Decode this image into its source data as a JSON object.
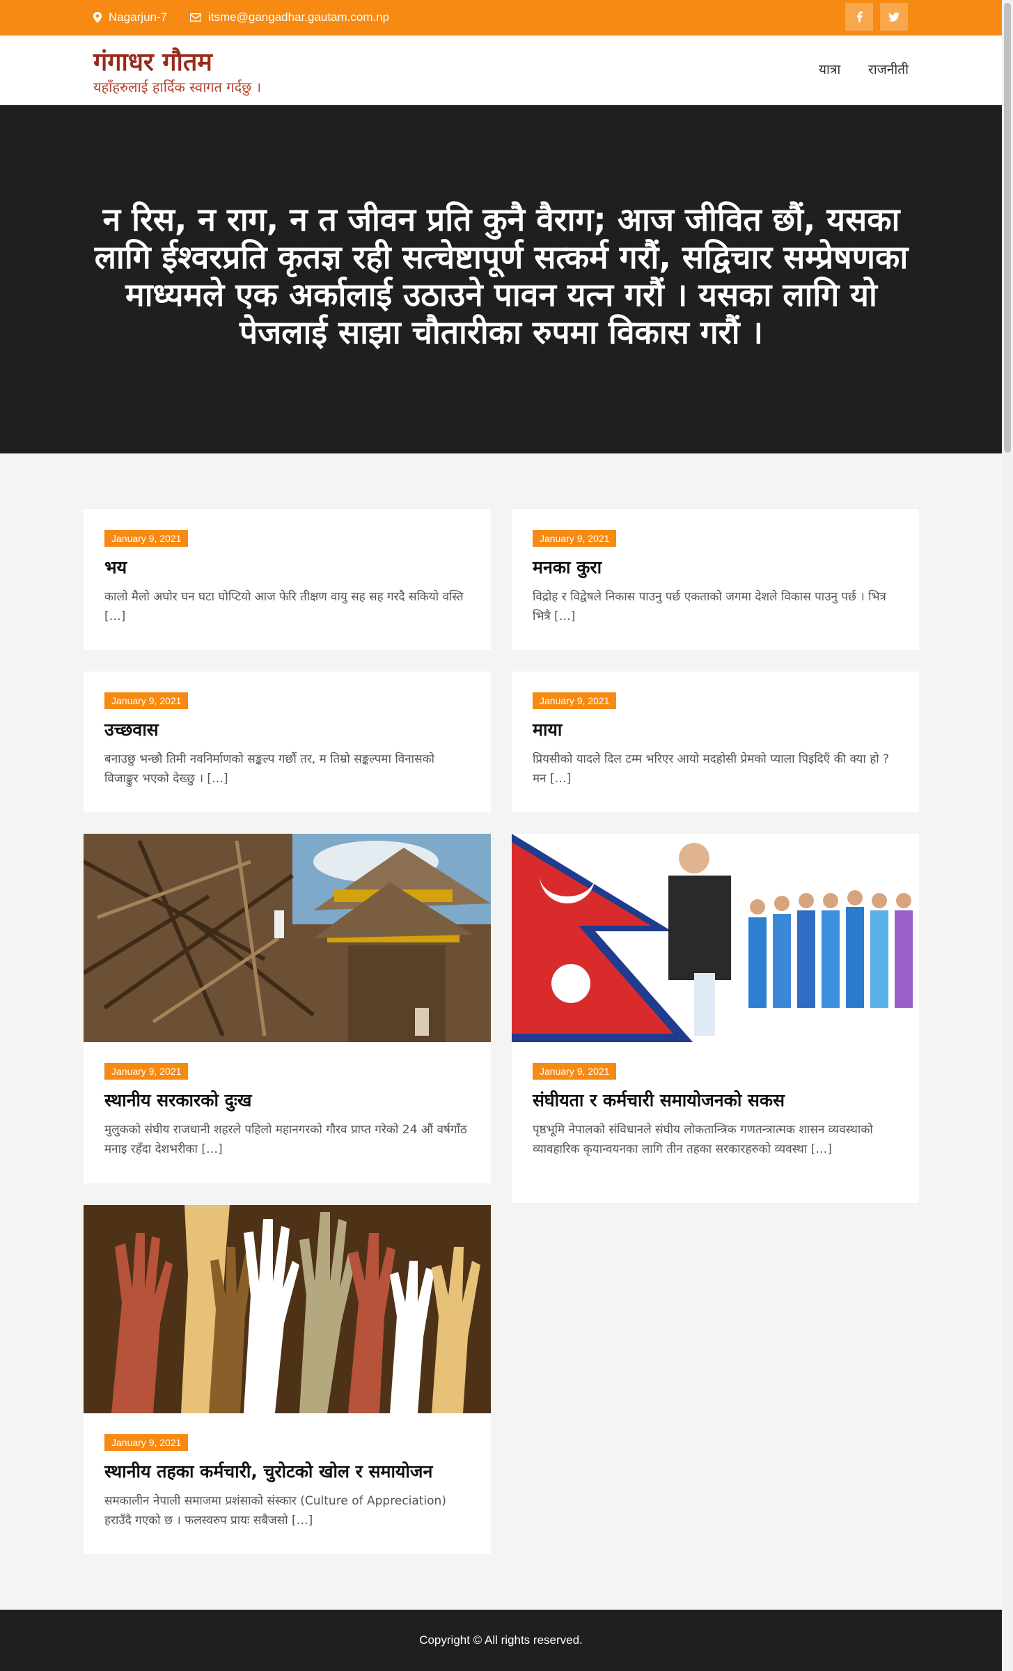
{
  "topbar": {
    "location": "Nagarjun-7",
    "email": "itsme@gangadhar.gautam.com.np"
  },
  "header": {
    "site_title": "गंगाधर गौतम",
    "tagline": "यहाँहरुलाई हार्दिक स्वागत गर्दछु ।",
    "nav": [
      "यात्रा",
      "राजनीती"
    ]
  },
  "hero": {
    "text": "न रिस, न राग, न त जीवन प्रति कुनै वैराग; आज जीवित छौं, यसका लागि ईश्वरप्रति कृतज्ञ रही सत्चेष्टापूर्ण सत्कर्म गरौं, सद्विचार सम्प्रेषणका माध्यमले एक अर्कालाई उठाउने पावन यत्न गरौं । यसका लागि यो पेजलाई साझा चौतारीका रुपमा विकास गरौं ।"
  },
  "posts": [
    {
      "date": "January 9, 2021",
      "title": "भय",
      "excerpt": "कालो मैलो अघोर घन घटा घोप्टियो आज फेरि तीक्षण वायु  सह सह गरदै सकियो वस्ति […]"
    },
    {
      "date": "January 9, 2021",
      "title": "मनका कुरा",
      "excerpt": "विद्रोह र विद्वेषले निकास पाउनु पर्छ एकताको जगमा देशले विकास पाउनु पर्छ । भित्र भित्रै […]"
    },
    {
      "date": "January 9, 2021",
      "title": "उच्छवास",
      "excerpt": "बनाउछु भन्छौ तिमी नवनिर्माणको सङ्कल्प गर्छौ तर, म तिम्रो सङ्कल्पमा विनासको विजाङ्कुर भएको देख्छु । […]"
    },
    {
      "date": "January 9, 2021",
      "title": "माया",
      "excerpt": "प्रियसीको यादले दिल टम्म भरिएर आयो मदहोसी प्रेमको प्याला पिइदिएँ की क्या हो ? मन […]"
    },
    {
      "date": "January 9, 2021",
      "title": "स्थानीय सरकारको दुःख",
      "excerpt": "मुलुकको संघीय राजधानी शहरले पहिलो महानगरको गौरव प्राप्त गरेको 24 औं वर्षगाँठ मनाइ रहँदा देशभरीका […]"
    },
    {
      "date": "January 9, 2021",
      "title": "संघीयता र कर्मचारी समायोजनको सकस",
      "excerpt": "पृष्ठभूमि नेपालको संविधानले संघीय लोकतान्त्रिक गणतन्त्रात्मक शासन व्यवस्थाको व्यावहारिक कृयान्वयनका लागि तीन तहका सरकारहरुको व्यवस्था […]"
    },
    {
      "date": "January 9, 2021",
      "title": "स्थानीय तहका कर्मचारी, चुरोटको खोल र समायोजन",
      "excerpt": "समकालीन नेपाली समाजमा प्रशंसाको संस्कार (Culture of Appreciation) हराउँदै गएको छ । फलस्वरुप प्रायः सबैजसो […]"
    }
  ],
  "footer": {
    "text": "Copyright © All rights reserved."
  },
  "colors": {
    "accent": "#f68a12",
    "brand": "#9a2a1d",
    "dark": "#1f1f1f"
  },
  "icons": [
    "map-marker-icon",
    "envelope-icon",
    "facebook-icon",
    "twitter-icon"
  ]
}
